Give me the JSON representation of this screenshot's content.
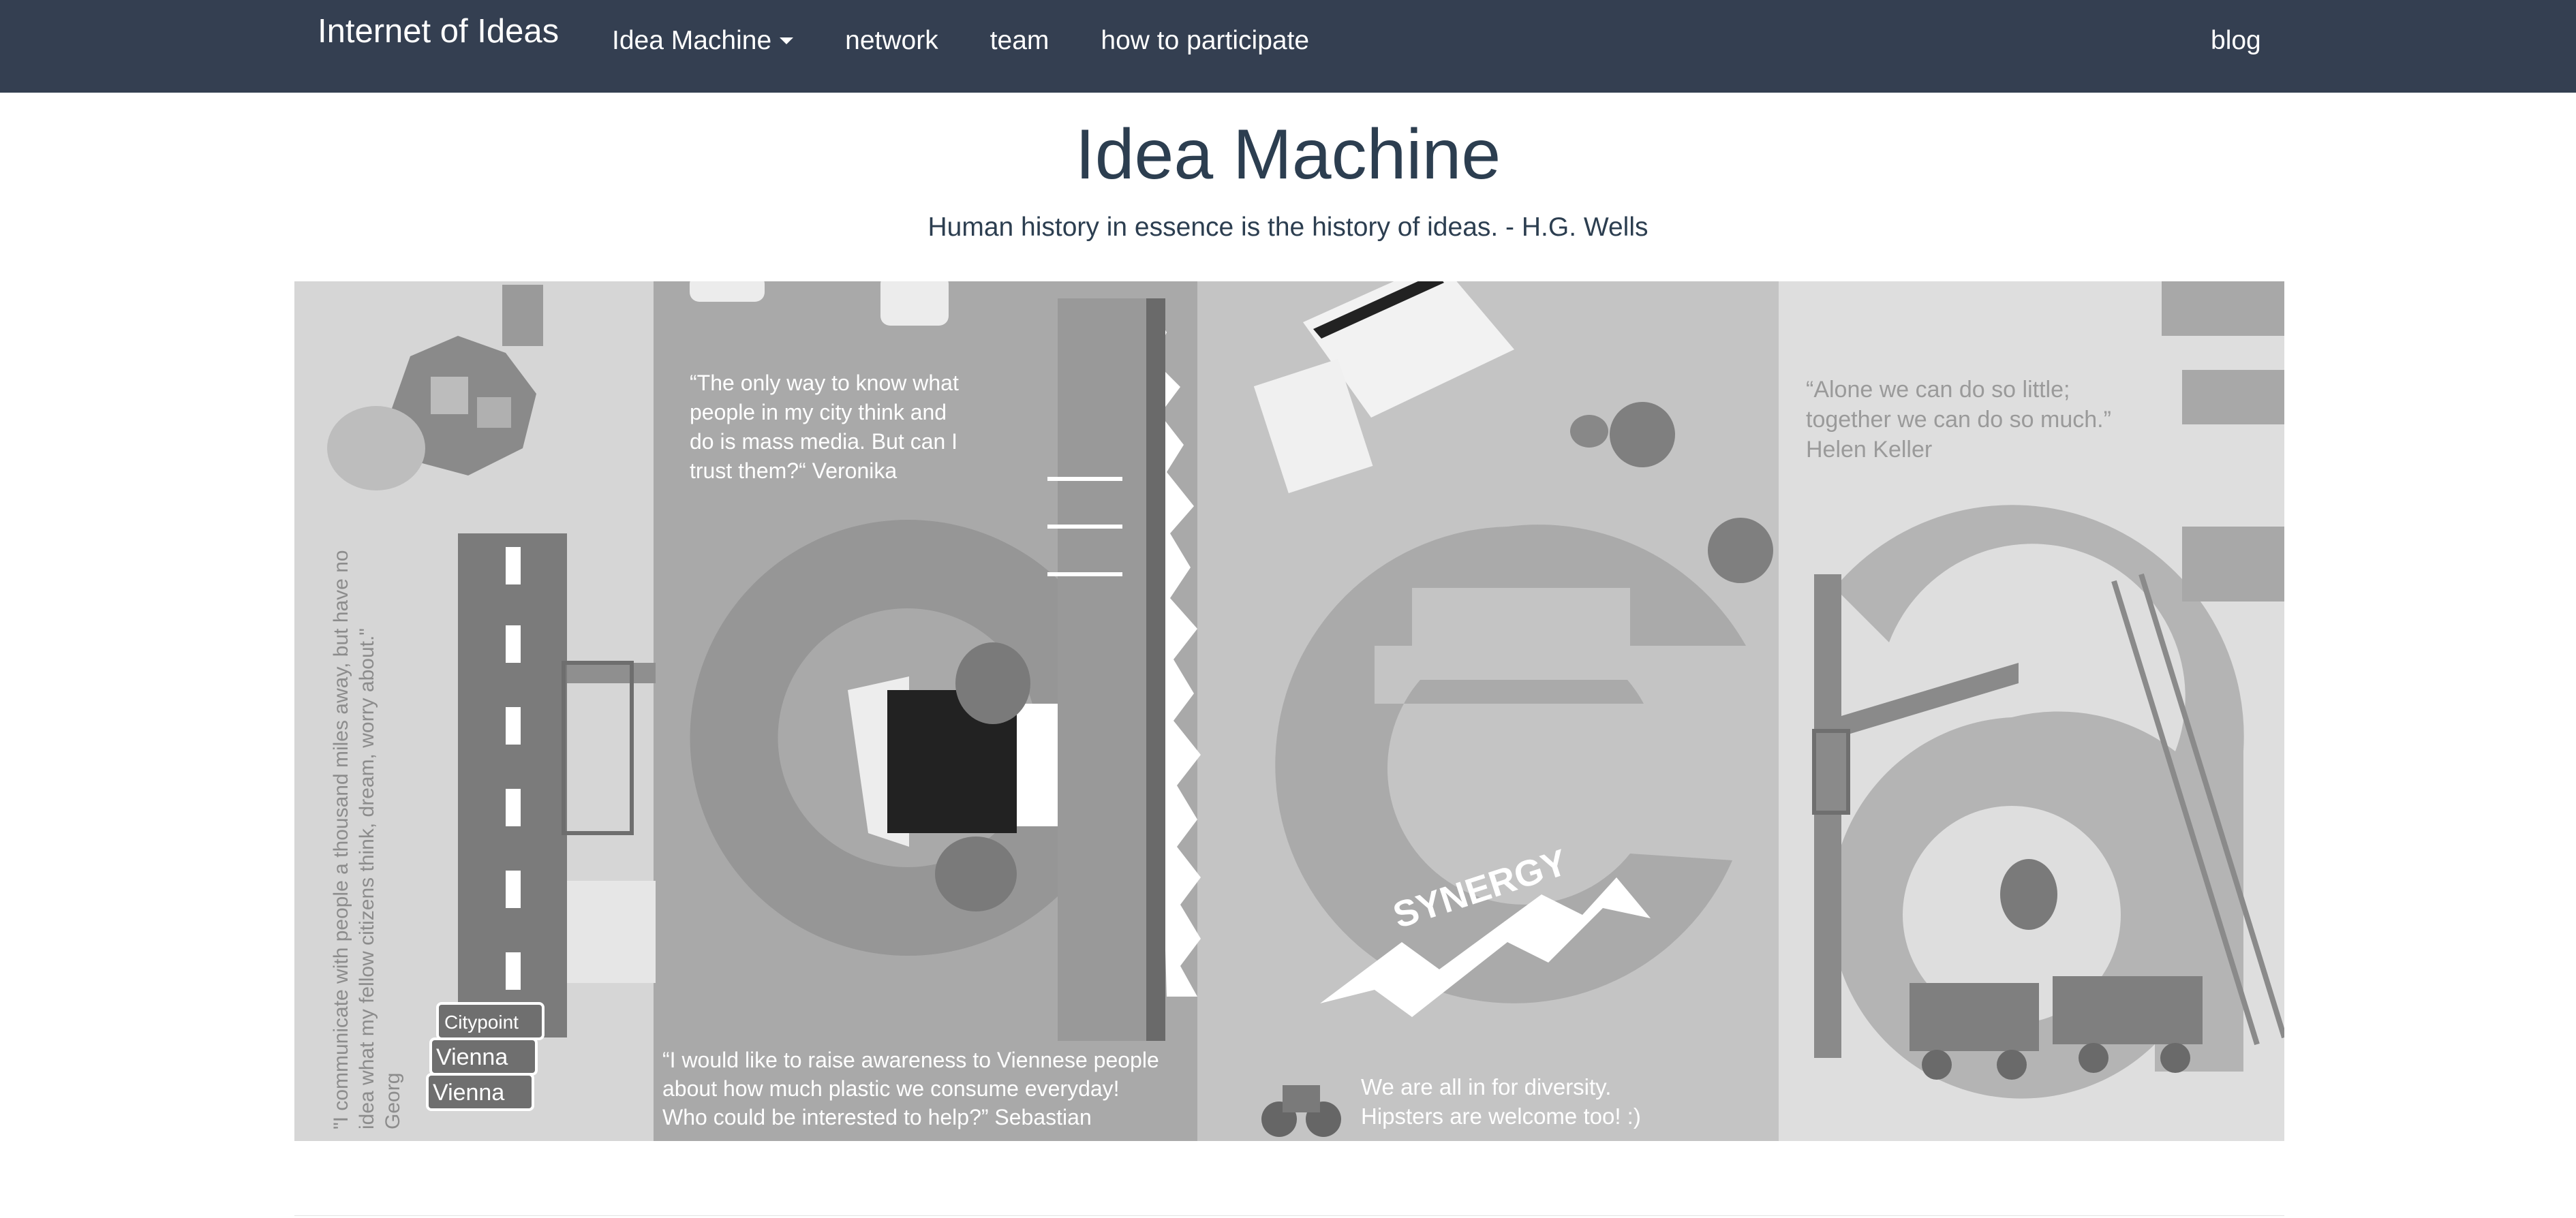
{
  "navbar": {
    "brand": "Internet of Ideas",
    "items": [
      {
        "label": "Idea Machine",
        "has_caret": true
      },
      {
        "label": "network"
      },
      {
        "label": "team"
      },
      {
        "label": "how to participate"
      }
    ],
    "right_item": "blog",
    "background_color": "#343f51"
  },
  "header": {
    "title": "Idea Machine",
    "subtitle": "Human history in essence is the history of ideas. - H.G. Wells"
  },
  "hero": {
    "quote_georg_1": "\"I communicate with people a thousand miles away, but have no",
    "quote_georg_2": "idea what my fellow citizens think, dream, worry about.\"",
    "quote_georg_3": "Georg",
    "sign_1": "Citypoint",
    "sign_2": "Vienna",
    "sign_3": "Vienna",
    "quote_veronika_1": "“The only way to know what",
    "quote_veronika_2": "people in my city think  and",
    "quote_veronika_3": "do is mass media. But can I",
    "quote_veronika_4": "trust them?“ Veronika",
    "quote_sebastian_1": "“I would like to raise awareness to Viennese people",
    "quote_sebastian_2": "about how much plastic we consume everyday!",
    "quote_sebastian_3": "Who could be interested to help?”   Sebastian",
    "synergy": "SYNERGY",
    "diversity_1": "We are all in for diversity.",
    "diversity_2": "Hipsters are welcome too! :)",
    "quote_keller_1": "“Alone we can do so little;",
    "quote_keller_2": "together we can do so much.”",
    "quote_keller_3": "Helen Keller"
  }
}
